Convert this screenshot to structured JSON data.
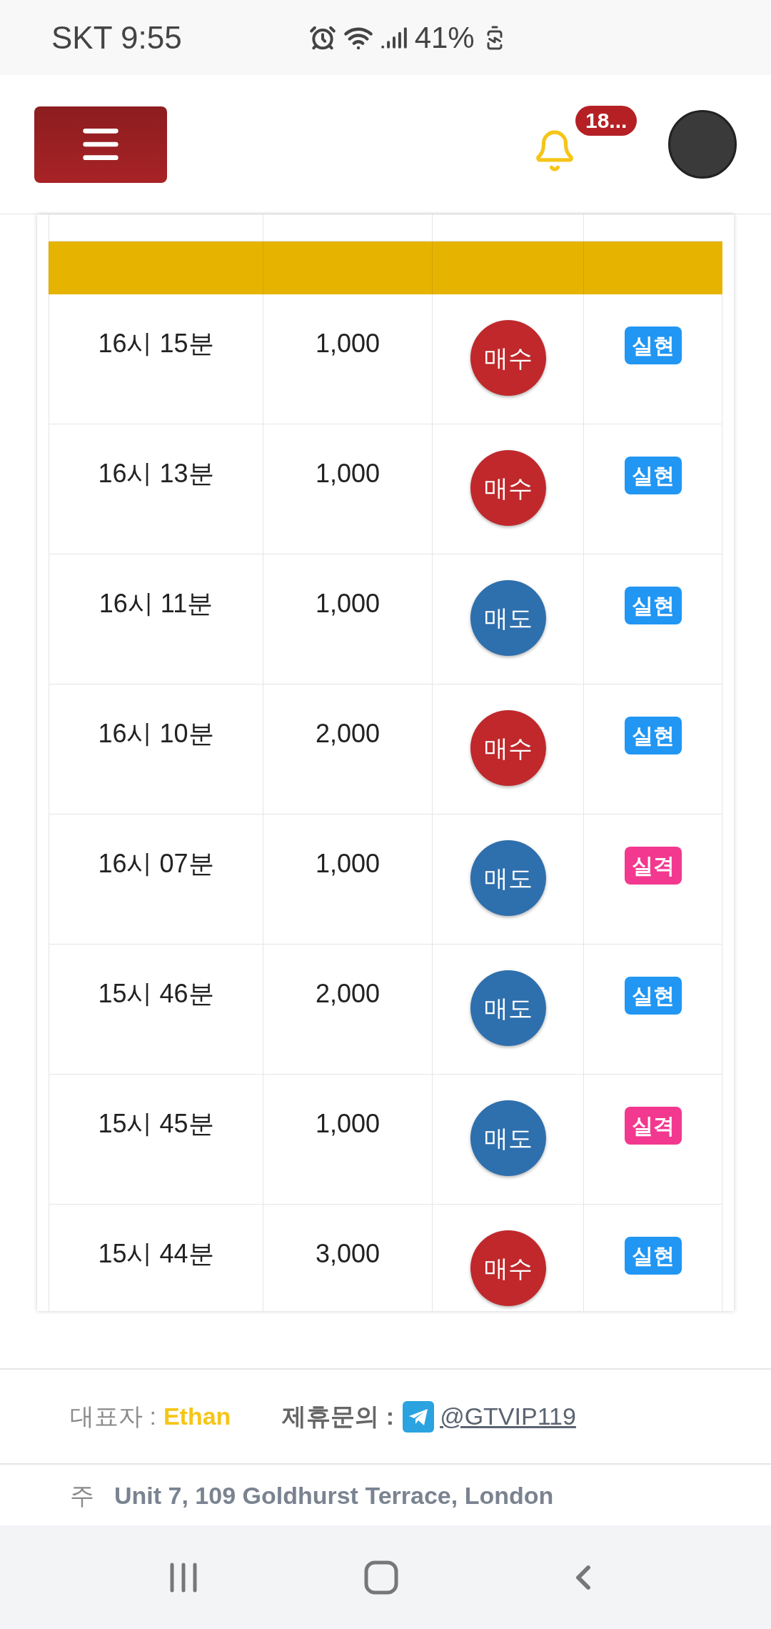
{
  "status_bar": {
    "carrier_time": "SKT 9:55",
    "battery": "41%"
  },
  "header": {
    "notification_count": "18..."
  },
  "table": {
    "rows": [
      {
        "time": "16시 15분",
        "amount": "1,000",
        "side": {
          "label": "매수",
          "kind": "buy"
        },
        "result": {
          "label": "실현",
          "kind": "success"
        }
      },
      {
        "time": "16시 13분",
        "amount": "1,000",
        "side": {
          "label": "매수",
          "kind": "buy"
        },
        "result": {
          "label": "실현",
          "kind": "success"
        }
      },
      {
        "time": "16시 11분",
        "amount": "1,000",
        "side": {
          "label": "매도",
          "kind": "sell"
        },
        "result": {
          "label": "실현",
          "kind": "success"
        }
      },
      {
        "time": "16시 10분",
        "amount": "2,000",
        "side": {
          "label": "매수",
          "kind": "buy"
        },
        "result": {
          "label": "실현",
          "kind": "success"
        }
      },
      {
        "time": "16시 07분",
        "amount": "1,000",
        "side": {
          "label": "매도",
          "kind": "sell"
        },
        "result": {
          "label": "실격",
          "kind": "fail"
        }
      },
      {
        "time": "15시 46분",
        "amount": "2,000",
        "side": {
          "label": "매도",
          "kind": "sell"
        },
        "result": {
          "label": "실현",
          "kind": "success"
        }
      },
      {
        "time": "15시 45분",
        "amount": "1,000",
        "side": {
          "label": "매도",
          "kind": "sell"
        },
        "result": {
          "label": "실격",
          "kind": "fail"
        }
      },
      {
        "time": "15시 44분",
        "amount": "3,000",
        "side": {
          "label": "매수",
          "kind": "buy"
        },
        "result": {
          "label": "실현",
          "kind": "success"
        }
      }
    ]
  },
  "footer": {
    "representative_label": "대표자 :",
    "representative": "Ethan",
    "partnership_label": "제휴문의 :",
    "telegram_handle": "@GTVIP119",
    "address_label": "주",
    "address": "Unit 7, 109 Goldhurst Terrace, London"
  }
}
